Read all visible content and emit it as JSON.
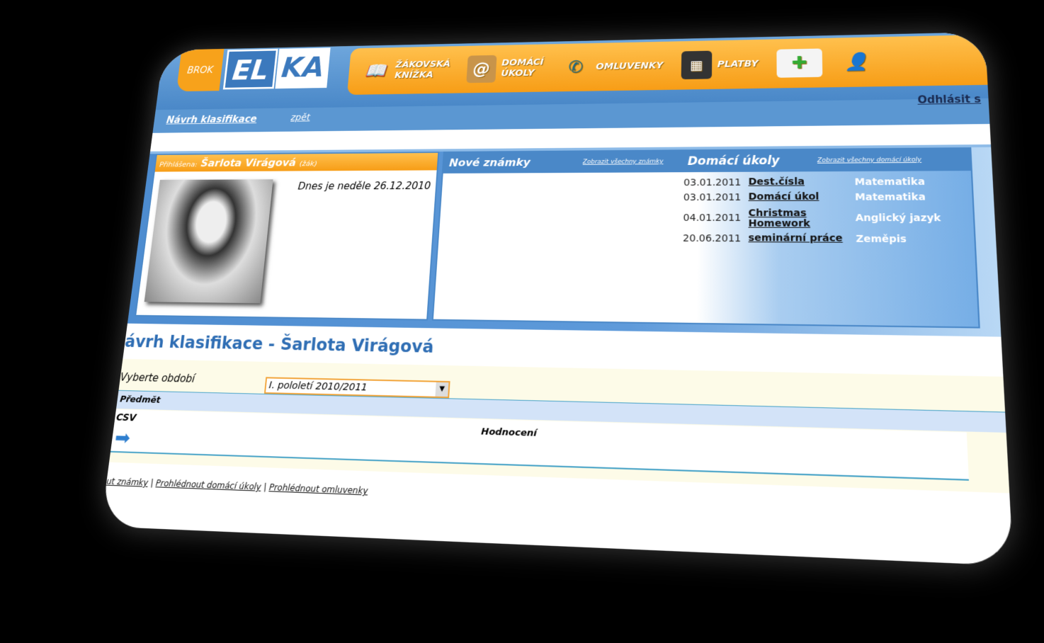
{
  "header": {
    "brand_left": "BROK",
    "logo_el": "EL",
    "logo_ka": "KA",
    "nav": [
      {
        "label1": "ŽÁKOVSKÁ",
        "label2": "KNÍŽKA",
        "icon": "book-icon"
      },
      {
        "label1": "DOMÁCÍ",
        "label2": "ÚKOLY",
        "icon": "address-book-icon"
      },
      {
        "label1": "OMLUVENKY",
        "label2": "",
        "icon": "phone-icon"
      },
      {
        "label1": "PLATBY",
        "label2": "",
        "icon": "calculator-icon"
      }
    ],
    "mail_icon": "new-mail-icon",
    "user_icon": "user-icon"
  },
  "subnav": {
    "current": "Návrh klasifikace",
    "back": "zpět",
    "logout": "Odhlásit s"
  },
  "profile": {
    "logged_prefix": "Přihlášena:",
    "name": "Šarlota Virágová",
    "role": "(žák)",
    "today": "Dnes je neděle 26.12.2010"
  },
  "news": {
    "grades_title": "Nové známky",
    "grades_all": "Zobrazit všechny známky",
    "hw_title": "Domácí úkoly",
    "hw_all": "Zobrazit všechny domácí úkoly",
    "homework": [
      {
        "date": "03.01.2011",
        "task": "Dest.čísla",
        "subject": "Matematika"
      },
      {
        "date": "03.01.2011",
        "task": "Domácí úkol",
        "subject": "Matematika"
      },
      {
        "date": "04.01.2011",
        "task": "Christmas Homework",
        "subject": "Anglický jazyk"
      },
      {
        "date": "20.06.2011",
        "task": "seminární práce",
        "subject": "Zeměpis"
      }
    ]
  },
  "main": {
    "title": "ávrh klasifikace - Šarlota Virágová",
    "period_label": "Vyberte období",
    "period_value": "I. pololetí 2010/2011",
    "col_subject": "Předmět",
    "csv": "CSV",
    "col_rating": "Hodnocení"
  },
  "footer": {
    "links": [
      "ut známky",
      "Prohlédnout domácí úkoly",
      "Prohlédnout omluvenky"
    ],
    "sep": "|"
  }
}
